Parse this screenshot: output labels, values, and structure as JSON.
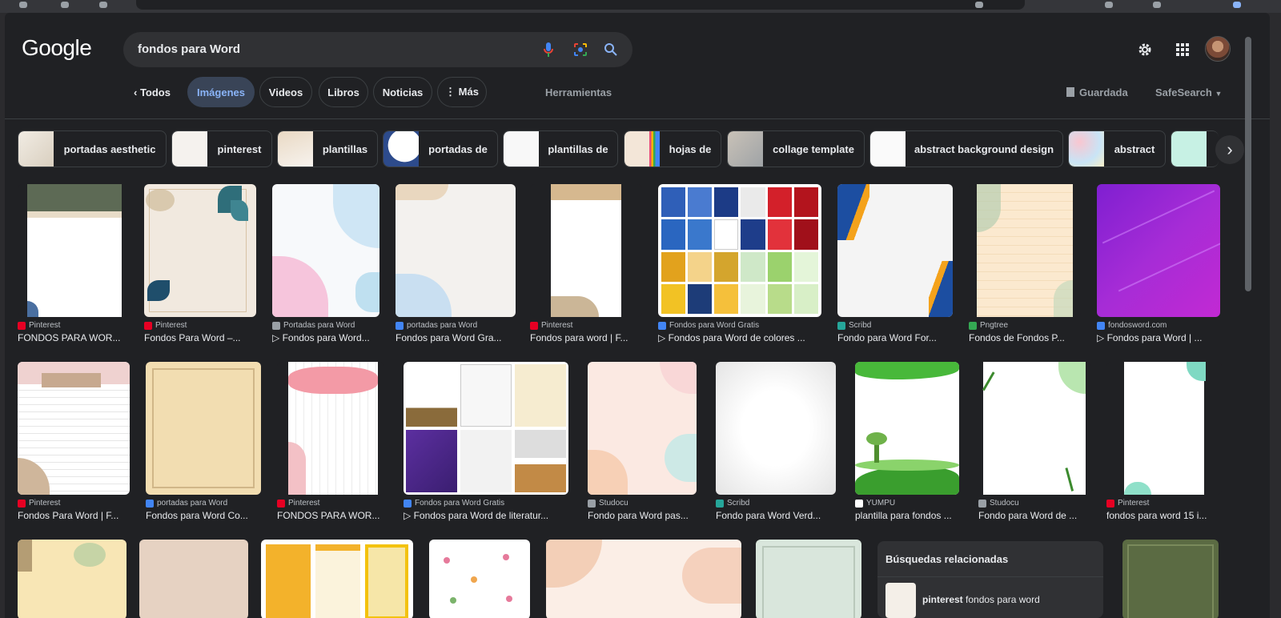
{
  "search": {
    "query": "fondos para Word"
  },
  "logo": "Google",
  "tabs": [
    {
      "label": "‹  Todos"
    },
    {
      "label": "Imágenes"
    },
    {
      "label": "Videos"
    },
    {
      "label": "Libros"
    },
    {
      "label": "Noticias"
    },
    {
      "label": "⋮ Más"
    }
  ],
  "tools": {
    "herramientas": "Herramientas",
    "guardada": "Guardada",
    "safesearch": "SafeSearch"
  },
  "chips": [
    "portadas aesthetic",
    "pinterest",
    "plantillas",
    "portadas de",
    "plantillas de",
    "hojas de",
    "collage template",
    "abstract background design",
    "abstract"
  ],
  "results": [
    {
      "source": "Pinterest",
      "title": "FONDOS PARA WOR..."
    },
    {
      "source": "Pinterest",
      "title": "Fondos Para Word –..."
    },
    {
      "source": "Portadas para Word",
      "title": "▷ Fondos para Word..."
    },
    {
      "source": "portadas para Word",
      "title": "Fondos para Word Gra..."
    },
    {
      "source": "Pinterest",
      "title": "Fondos para word | F..."
    },
    {
      "source": "Fondos para Word Gratis",
      "title": "▷ Fondos para Word de colores ..."
    },
    {
      "source": "Scribd",
      "title": "Fondo para Word For..."
    },
    {
      "source": "Pngtree",
      "title": "Fondos de Fondos P..."
    },
    {
      "source": "fondosword.com",
      "title": "▷ Fondos para Word | ..."
    },
    {
      "source": "Pinterest",
      "title": "Fondos Para Word | F..."
    },
    {
      "source": "portadas para Word",
      "title": "Fondos para Word Co..."
    },
    {
      "source": "Pinterest",
      "title": "FONDOS PARA WOR..."
    },
    {
      "source": "Fondos para Word Gratis",
      "title": "▷ Fondos para Word de literatur..."
    },
    {
      "source": "Studocu",
      "title": "Fondo para Word pas..."
    },
    {
      "source": "Scribd",
      "title": "Fondo para Word Verd..."
    },
    {
      "source": "YUMPU",
      "title": "plantilla para fondos ..."
    },
    {
      "source": "Studocu",
      "title": "Fondo para Word de ..."
    },
    {
      "source": "Pinterest",
      "title": "fondos para word 15 i..."
    }
  ],
  "related": {
    "heading": "Búsquedas relacionadas",
    "item_bold": "pinterest",
    "item_rest": "fondos para word"
  },
  "colors": {
    "background": "#202124",
    "accent": "#8ab4f8",
    "active_tab_bg": "#394457"
  }
}
